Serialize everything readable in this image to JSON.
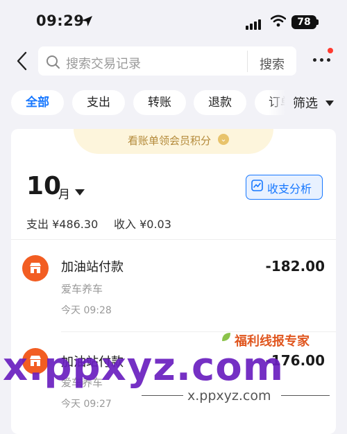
{
  "status_bar": {
    "time": "09:29",
    "battery": "78"
  },
  "search": {
    "placeholder": "搜索交易记录",
    "button": "搜索"
  },
  "filters": {
    "chips": [
      "全部",
      "支出",
      "转账",
      "退款",
      "订单"
    ],
    "filter_label": "筛选"
  },
  "banner": {
    "text": "看账单领会员积分"
  },
  "summary": {
    "month": "10",
    "month_unit": "月",
    "analysis_button": "收支分析",
    "expense": "支出 ¥486.30",
    "income": "收入 ¥0.03"
  },
  "transactions": [
    {
      "title": "加油站付款",
      "category": "爱车养车",
      "time": "今天 09:28",
      "amount": "-182.00"
    },
    {
      "title": "加油站付款",
      "category": "爱车养车",
      "time": "今天 09:27",
      "amount": "-176.00"
    }
  ],
  "watermark": {
    "badge": "福利线报专家",
    "main": "x.ppxyz.com",
    "sub": "x.ppxyz.com"
  },
  "colors": {
    "accent": "#1677ff",
    "merchant_icon": "#f25d22",
    "banner_bg": "#fdf5dc",
    "watermark": "#6a1fbf"
  }
}
